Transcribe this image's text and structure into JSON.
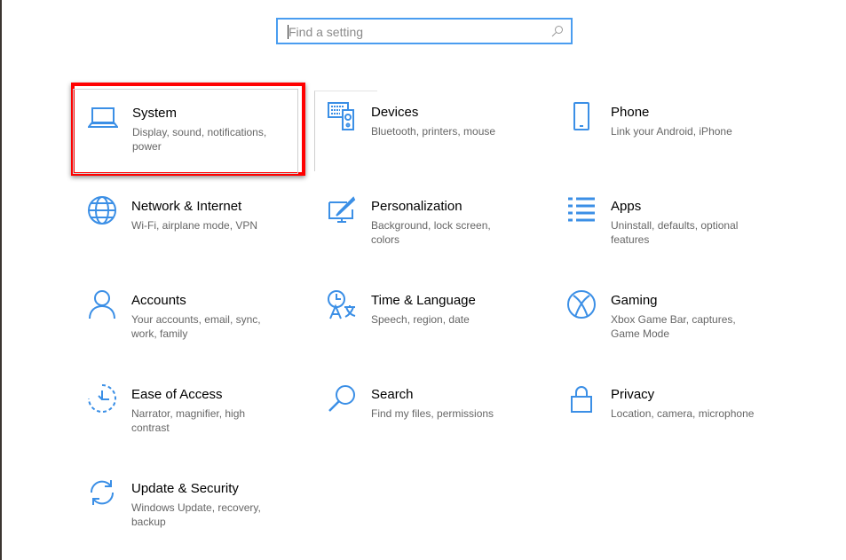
{
  "search": {
    "placeholder": "Find a setting"
  },
  "accent": "#3b8fe6",
  "highlight_color": "#ff0000",
  "tiles": [
    {
      "title": "System",
      "desc": "Display, sound, notifications, power",
      "icon": "laptop-icon"
    },
    {
      "title": "Devices",
      "desc": "Bluetooth, printers, mouse",
      "icon": "devices-icon"
    },
    {
      "title": "Phone",
      "desc": "Link your Android, iPhone",
      "icon": "phone-icon"
    },
    {
      "title": "Network & Internet",
      "desc": "Wi-Fi, airplane mode, VPN",
      "icon": "globe-icon"
    },
    {
      "title": "Personalization",
      "desc": "Background, lock screen, colors",
      "icon": "paint-icon"
    },
    {
      "title": "Apps",
      "desc": "Uninstall, defaults, optional features",
      "icon": "apps-list-icon"
    },
    {
      "title": "Accounts",
      "desc": "Your accounts, email, sync, work, family",
      "icon": "person-icon"
    },
    {
      "title": "Time & Language",
      "desc": "Speech, region, date",
      "icon": "time-language-icon"
    },
    {
      "title": "Gaming",
      "desc": "Xbox Game Bar, captures, Game Mode",
      "icon": "xbox-icon"
    },
    {
      "title": "Ease of Access",
      "desc": "Narrator, magnifier, high contrast",
      "icon": "ease-of-access-icon"
    },
    {
      "title": "Search",
      "desc": "Find my files, permissions",
      "icon": "search-icon"
    },
    {
      "title": "Privacy",
      "desc": "Location, camera, microphone",
      "icon": "lock-icon"
    },
    {
      "title": "Update & Security",
      "desc": "Windows Update, recovery, backup",
      "icon": "sync-icon"
    }
  ]
}
